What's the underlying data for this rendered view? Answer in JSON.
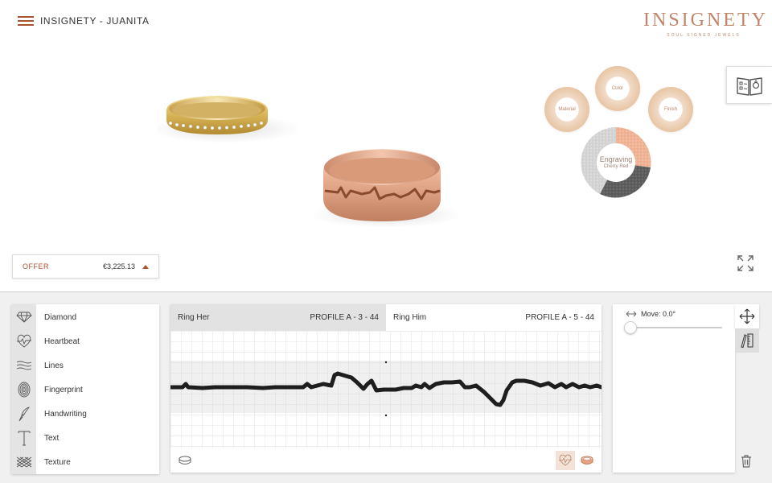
{
  "header": {
    "title": "INSIGNETY - JUANITA",
    "brand_name": "INSIGNETY",
    "brand_tagline": "SOUL SIGNED JEWELS"
  },
  "options": {
    "material": "Material",
    "color": "Color",
    "finish": "Finish",
    "engraving_title": "Engraving",
    "engraving_value": "Cherry Red"
  },
  "offer": {
    "label": "OFFER",
    "price": "€3,225.13"
  },
  "patterns": [
    {
      "label": "Diamond",
      "icon": "diamond-icon"
    },
    {
      "label": "Heartbeat",
      "icon": "heartbeat-icon"
    },
    {
      "label": "Lines",
      "icon": "lines-icon"
    },
    {
      "label": "Fingerprint",
      "icon": "fingerprint-icon"
    },
    {
      "label": "Handwriting",
      "icon": "feather-icon"
    },
    {
      "label": "Text",
      "icon": "text-icon"
    },
    {
      "label": "Texture",
      "icon": "texture-icon"
    }
  ],
  "editor": {
    "tabs": [
      {
        "name": "Ring Her",
        "profile": "PROFILE A - 3 - 44",
        "active": true
      },
      {
        "name": "Ring Him",
        "profile": "PROFILE A - 5 - 44",
        "active": false
      }
    ]
  },
  "transform": {
    "move_label": "Move: 0.0°",
    "move_value": 0
  },
  "colors": {
    "accent": "#a9532f",
    "brand": "#c08569",
    "engraving_line": "#1e1e1e"
  }
}
